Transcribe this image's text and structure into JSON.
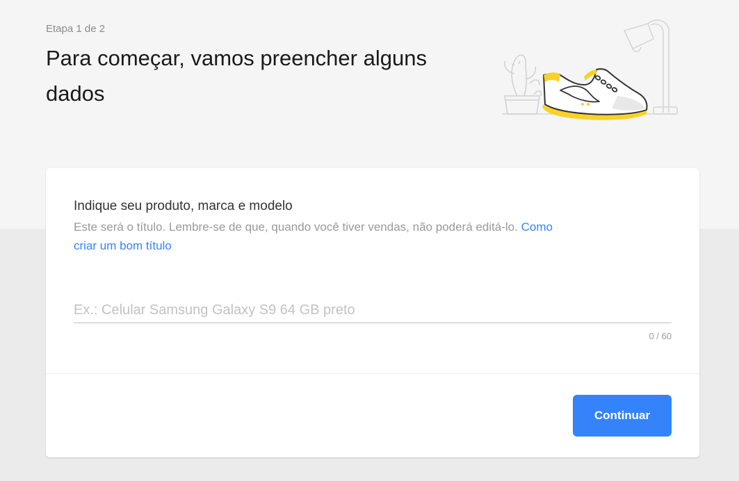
{
  "header": {
    "step": "Etapa 1 de 2",
    "title": "Para começar, vamos preencher alguns dados"
  },
  "illustration": {
    "icon": "sneaker-illustration",
    "accent_color": "#f7d22b"
  },
  "form": {
    "question": "Indique seu produto, marca e modelo",
    "help_text": "Este será o título. Lembre-se de que, quando você tiver vendas, não poderá editá-lo.",
    "help_link": "Como criar um bom título",
    "input_value": "",
    "input_placeholder": "Ex.: Celular Samsung Galaxy S9 64 GB preto",
    "counter": "0 / 60"
  },
  "actions": {
    "continue_label": "Continuar"
  },
  "colors": {
    "primary": "#3483fa",
    "background": "#ebebeb",
    "header_background": "#f5f5f5",
    "card": "#ffffff"
  }
}
